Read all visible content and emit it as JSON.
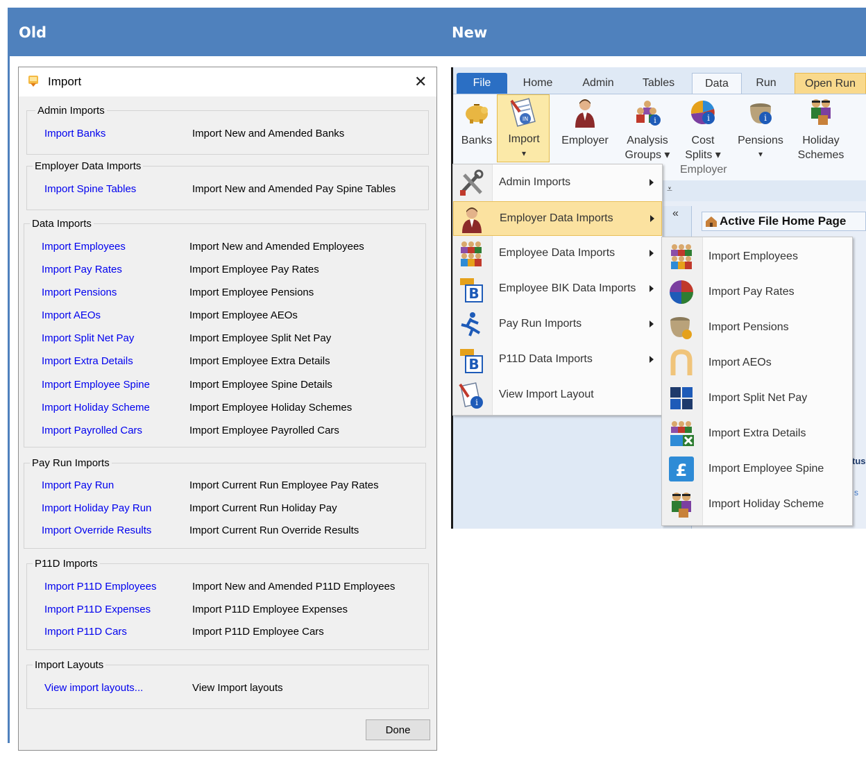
{
  "header": {
    "old_label": "Old",
    "new_label": "New"
  },
  "old_dialog": {
    "title": "Import",
    "close_glyph": "✕",
    "groups": [
      {
        "label": "Admin Imports",
        "rows": [
          {
            "link": "Import Banks",
            "desc": "Import New and Amended Banks"
          }
        ]
      },
      {
        "label": "Employer Data Imports",
        "rows": [
          {
            "link": "Import Spine Tables",
            "desc": "Import New and Amended Pay Spine Tables"
          }
        ]
      },
      {
        "label": "Data Imports",
        "rows": [
          {
            "link": "Import Employees",
            "desc": "Import New and Amended Employees"
          },
          {
            "link": "Import Pay Rates",
            "desc": "Import Employee Pay Rates"
          },
          {
            "link": "Import Pensions",
            "desc": "Import Employee Pensions"
          },
          {
            "link": "Import AEOs",
            "desc": "Import Employee AEOs"
          },
          {
            "link": "Import Split Net Pay",
            "desc": "Import Employee Split Net Pay"
          },
          {
            "link": "Import Extra Details",
            "desc": "Import Employee Extra Details"
          },
          {
            "link": "Import Employee Spine",
            "desc": "Import Employee Spine Details"
          },
          {
            "link": "Import Holiday Scheme",
            "desc": "Import Employee Holiday Schemes"
          },
          {
            "link": "Import Payrolled Cars",
            "desc": "Import Employee Payrolled Cars"
          }
        ]
      },
      {
        "label": "Pay Run Imports",
        "rows": [
          {
            "link": "Import Pay Run",
            "desc": "Import Current Run Employee Pay Rates"
          },
          {
            "link": "Import Holiday Pay Run",
            "desc": "Import Current Run Holiday Pay"
          },
          {
            "link": "Import Override Results",
            "desc": "Import Current Run Override Results"
          }
        ]
      },
      {
        "label": "P11D Imports",
        "rows": [
          {
            "link": "Import P11D Employees",
            "desc": "Import New and Amended P11D Employees"
          },
          {
            "link": "Import P11D Expenses",
            "desc": "Import P11D Employee Expenses"
          },
          {
            "link": "Import P11D Cars",
            "desc": "Import P11D Employee Cars"
          }
        ]
      },
      {
        "label": "Import Layouts",
        "rows": [
          {
            "link": "View import layouts...",
            "desc": "View Import layouts"
          }
        ]
      }
    ],
    "done_label": "Done"
  },
  "ribbon": {
    "tabs": [
      "File",
      "Home",
      "Admin",
      "Tables",
      "Data",
      "Run",
      "Open Run"
    ],
    "active_tab": "Data",
    "buttons": [
      {
        "label": "Banks",
        "icon": "piggy-bank-icon"
      },
      {
        "label": "Import",
        "icon": "import-document-icon",
        "dropdown": "▾"
      },
      {
        "label": "Employer",
        "icon": "employer-person-icon"
      },
      {
        "label": "Analysis Groups ▾",
        "label1": "Analysis",
        "label2": "Groups ▾",
        "icon": "people-group-info-icon"
      },
      {
        "label": "Cost Splits ▾",
        "label1": "Cost",
        "label2": "Splits ▾",
        "icon": "cost-splits-icon"
      },
      {
        "label": "Pensions",
        "icon": "pension-pot-icon",
        "dropdown": "▾"
      },
      {
        "label": "Holiday Schemes",
        "label1": "Holiday",
        "label2": "Schemes",
        "icon": "holiday-people-icon"
      }
    ],
    "group_label": "Employer",
    "collapse_glyph": "«",
    "active_file_home_page": "Active File Home Page",
    "partial_text": "tus",
    "partial_text2": "s",
    "colors": {
      "file_tab": "#2b6fc4",
      "highlight": "#fbe2a0",
      "open_run_tab": "#f9d98c"
    }
  },
  "import_menu": {
    "items": [
      {
        "label": "Admin Imports",
        "icon": "tools-icon",
        "submenu": true
      },
      {
        "label": "Employer Data Imports",
        "icon": "employer-person-icon",
        "submenu": true,
        "highlighted": true
      },
      {
        "label": "Employee Data Imports",
        "icon": "employees-group-icon",
        "submenu": true
      },
      {
        "label": "Employee BIK Data Imports",
        "icon": "bik-b-icon",
        "submenu": true
      },
      {
        "label": "Pay Run Imports",
        "icon": "running-man-icon",
        "submenu": true
      },
      {
        "label": "P11D Data Imports",
        "icon": "p11d-b-icon",
        "submenu": true
      },
      {
        "label": "View Import Layout",
        "icon": "import-layout-info-icon",
        "submenu": false
      }
    ]
  },
  "import_submenu": {
    "items": [
      {
        "label": "Import Employees",
        "icon": "employees-group-icon"
      },
      {
        "label": "Import Pay Rates",
        "icon": "pie-chart-icon"
      },
      {
        "label": "Import Pensions",
        "icon": "pension-pot-icon"
      },
      {
        "label": "Import AEOs",
        "icon": "aeo-horseshoe-icon"
      },
      {
        "label": "Import Split Net Pay",
        "icon": "split-net-pay-icon"
      },
      {
        "label": "Import Extra Details",
        "icon": "extra-details-icon"
      },
      {
        "label": "Import Employee Spine",
        "icon": "pound-spine-icon"
      },
      {
        "label": "Import Holiday Scheme",
        "icon": "holiday-people-icon"
      }
    ]
  }
}
